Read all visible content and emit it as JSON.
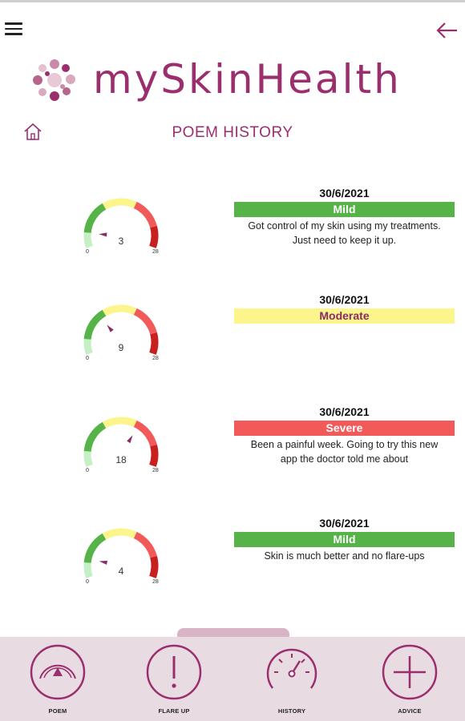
{
  "app": {
    "title": "mySkinHealth"
  },
  "page": {
    "title": "POEM HISTORY"
  },
  "colors": {
    "brand": "#9b2f6e",
    "mild": "#56b348",
    "moderate": "#fbf58c",
    "severe": "#f25a5a"
  },
  "icons": {
    "menu": "hamburger-icon",
    "back": "arrow-left-icon",
    "home": "home-icon"
  },
  "entries": [
    {
      "date": "30/6/2021",
      "severity": "Mild",
      "level": "mild",
      "score": "3",
      "score_value": 3,
      "min": "0",
      "max": "28",
      "note_line1": "Got control of my skin using my treatments.",
      "note_line2": "Just need to keep it up."
    },
    {
      "date": "30/6/2021",
      "severity": "Moderate",
      "level": "moderate",
      "score": "9",
      "score_value": 9,
      "min": "0",
      "max": "28",
      "note_line1": "",
      "note_line2": ""
    },
    {
      "date": "30/6/2021",
      "severity": "Severe",
      "level": "severe",
      "score": "18",
      "score_value": 18,
      "min": "0",
      "max": "28",
      "note_line1": "Been a painful week. Going to try this new",
      "note_line2": "app the doctor told me about"
    },
    {
      "date": "30/6/2021",
      "severity": "Mild",
      "level": "mild",
      "score": "4",
      "score_value": 4,
      "min": "0",
      "max": "28",
      "note_line1": "Skin is much better and no flare-ups",
      "note_line2": ""
    }
  ],
  "nav": [
    {
      "label": "POEM",
      "icon": "gauge-triangle-icon"
    },
    {
      "label": "FLARE UP",
      "icon": "exclamation-icon"
    },
    {
      "label": "HISTORY",
      "icon": "speedometer-icon"
    },
    {
      "label": "ADVICE",
      "icon": "plus-icon"
    }
  ]
}
